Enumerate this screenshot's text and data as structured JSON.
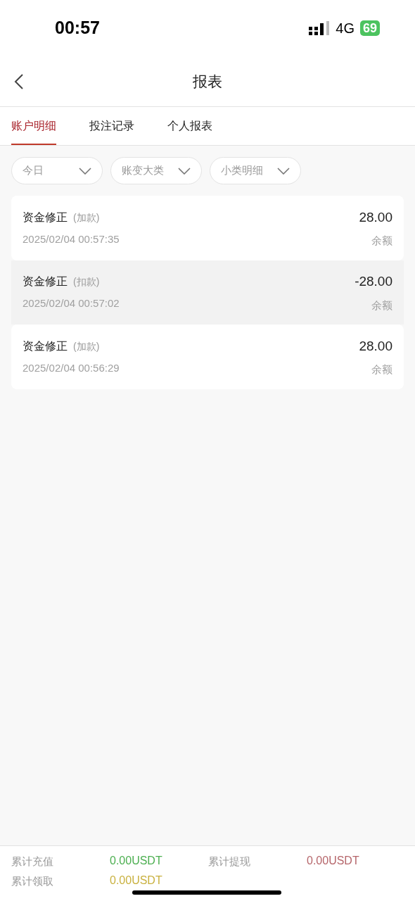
{
  "status_bar": {
    "time": "00:57",
    "network": "4G",
    "battery": "69"
  },
  "nav": {
    "title": "报表"
  },
  "tabs": [
    {
      "label": "账户明细",
      "selected": true
    },
    {
      "label": "投注记录",
      "selected": false
    },
    {
      "label": "个人报表",
      "selected": false
    }
  ],
  "filters": [
    {
      "label": "今日"
    },
    {
      "label": "账变大类"
    },
    {
      "label": "小类明细"
    }
  ],
  "records": [
    {
      "title": "资金修正",
      "type": "(加款)",
      "time": "2025/02/04 00:57:35",
      "amount": "28.00",
      "balance_label": "余额",
      "shaded": false
    },
    {
      "title": "资金修正",
      "type": "(扣款)",
      "time": "2025/02/04 00:57:02",
      "amount": "-28.00",
      "balance_label": "余额",
      "shaded": true
    },
    {
      "title": "资金修正",
      "type": "(加款)",
      "time": "2025/02/04 00:56:29",
      "amount": "28.00",
      "balance_label": "余额",
      "shaded": false
    }
  ],
  "summary": [
    {
      "label": "累计充值",
      "value": "0.00USDT",
      "color": "#4caf50"
    },
    {
      "label": "累计提现",
      "value": "0.00USDT",
      "color": "#b5656a"
    },
    {
      "label": "累计领取",
      "value": "0.00USDT",
      "color": "#c9b13f"
    }
  ]
}
